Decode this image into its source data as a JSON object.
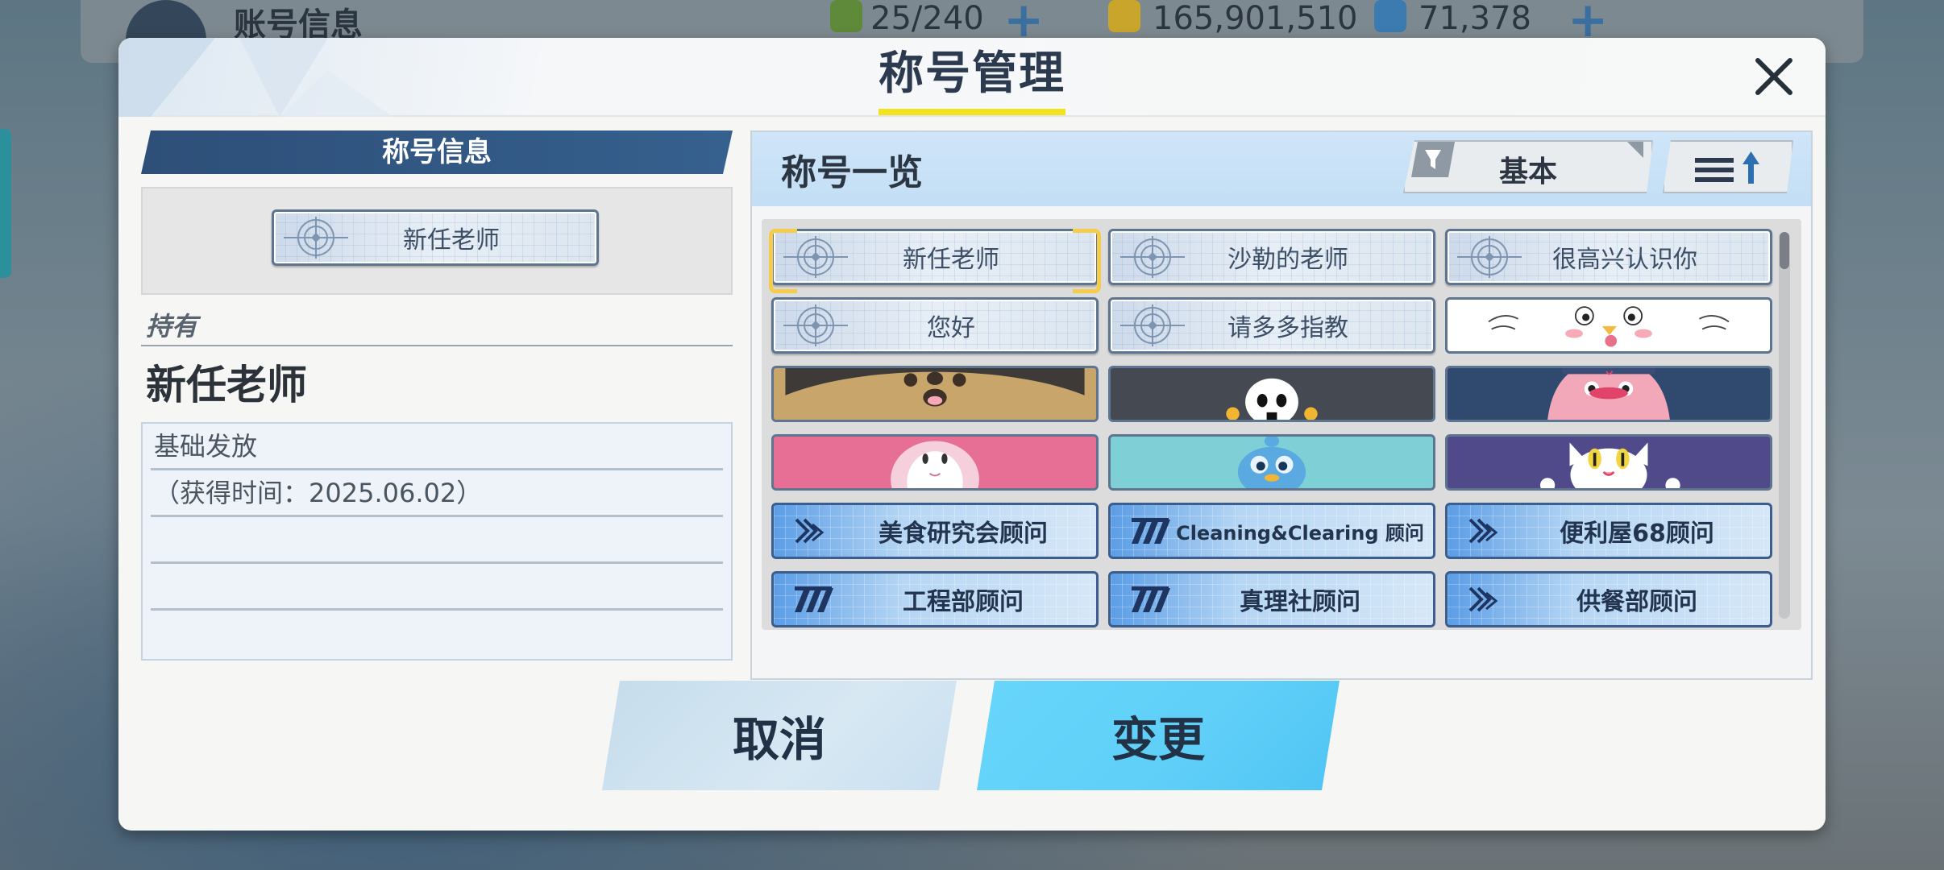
{
  "background": {
    "screen_title": "账号信息",
    "resources": [
      {
        "icon": "ap-icon",
        "value": "25/240"
      },
      {
        "icon": "credit-icon",
        "value": "165,901,510"
      },
      {
        "icon": "pyroxene-icon",
        "value": "71,378"
      }
    ]
  },
  "dialog": {
    "title": "称号管理",
    "close_icon": "close-icon"
  },
  "info_panel": {
    "header": "称号信息",
    "preview_title": "新任老师",
    "own_label": "持有",
    "own_name": "新任老师",
    "desc_lines": [
      "基础发放",
      "（获得时间：2025.06.02）",
      "",
      ""
    ]
  },
  "list_panel": {
    "header": "称号一览",
    "filter_label": "基本",
    "filter_icon": "filter-icon",
    "sort_icon": "sort-ascending-icon",
    "rows": [
      [
        {
          "type": "text",
          "label": "新任老师",
          "selected": true
        },
        {
          "type": "text",
          "label": "沙勒的老师"
        },
        {
          "type": "text",
          "label": "很高兴认识你"
        }
      ],
      [
        {
          "type": "text",
          "label": "您好"
        },
        {
          "type": "text",
          "label": "请多多指教"
        },
        {
          "type": "image",
          "art": "winged-face"
        }
      ],
      [
        {
          "type": "image",
          "art": "brown-bear"
        },
        {
          "type": "image",
          "art": "panda"
        },
        {
          "type": "image",
          "art": "pink-bird"
        }
      ],
      [
        {
          "type": "image",
          "art": "pink-bunny"
        },
        {
          "type": "image",
          "art": "teal-penguin"
        },
        {
          "type": "image",
          "art": "purple-cat"
        }
      ],
      [
        {
          "type": "advisor",
          "label": "美食研究会顾问",
          "emblem": "chevron-emblem"
        },
        {
          "type": "advisor",
          "label": "Cleaning&Clearing 顾问",
          "emblem": "slash-emblem"
        },
        {
          "type": "advisor",
          "label": "便利屋68顾问",
          "emblem": "chevron-emblem"
        }
      ],
      [
        {
          "type": "advisor",
          "label": "工程部顾问",
          "emblem": "slash-emblem"
        },
        {
          "type": "advisor",
          "label": "真理社顾问",
          "emblem": "slash-emblem"
        },
        {
          "type": "advisor",
          "label": "供餐部顾问",
          "emblem": "chevron-emblem"
        }
      ]
    ]
  },
  "buttons": {
    "cancel": "取消",
    "change": "变更"
  },
  "colors": {
    "accent_yellow": "#f3e21f",
    "header_blue": "#2d4f78",
    "change_button": "#5fcff8",
    "cancel_button": "#c5dcec"
  }
}
